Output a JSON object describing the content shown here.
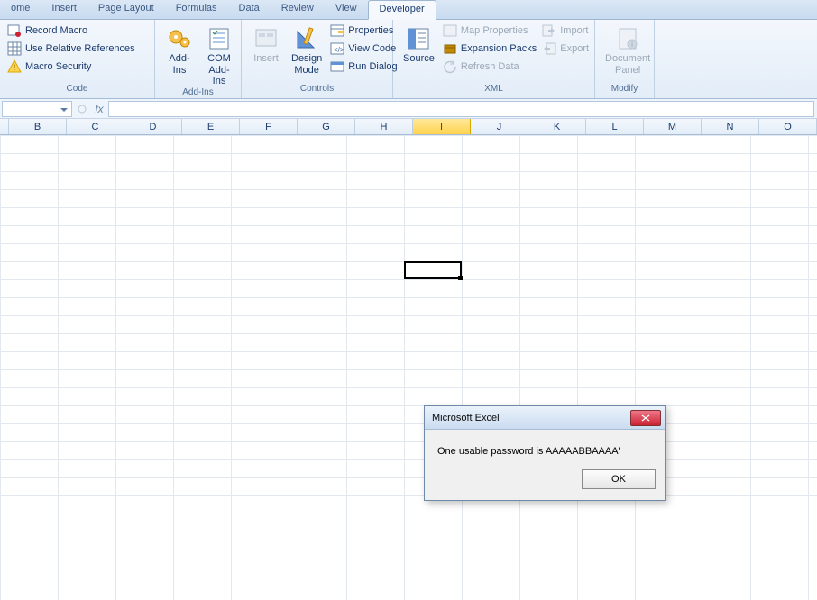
{
  "tabs": {
    "items": [
      {
        "label": "ome"
      },
      {
        "label": "Insert"
      },
      {
        "label": "Page Layout"
      },
      {
        "label": "Formulas"
      },
      {
        "label": "Data"
      },
      {
        "label": "Review"
      },
      {
        "label": "View"
      },
      {
        "label": "Developer"
      }
    ],
    "active_index": 7
  },
  "ribbon": {
    "code": {
      "label": "Code",
      "record_macro": "Record Macro",
      "use_relative": "Use Relative References",
      "macro_security": "Macro Security"
    },
    "addins": {
      "label": "Add-Ins",
      "addins_btn": "Add-Ins",
      "com_addins": "COM\nAdd-Ins"
    },
    "controls": {
      "label": "Controls",
      "insert": "Insert",
      "design_mode": "Design\nMode",
      "properties": "Properties",
      "view_code": "View Code",
      "run_dialog": "Run Dialog"
    },
    "xml": {
      "label": "XML",
      "source": "Source",
      "map_properties": "Map Properties",
      "expansion_packs": "Expansion Packs",
      "refresh_data": "Refresh Data",
      "import": "Import",
      "export": "Export"
    },
    "modify": {
      "label": "Modify",
      "document_panel": "Document\nPanel"
    }
  },
  "formula_bar": {
    "name_box": "",
    "fx": "fx"
  },
  "columns": [
    "B",
    "C",
    "D",
    "E",
    "F",
    "G",
    "H",
    "I",
    "J",
    "K",
    "L",
    "M",
    "N",
    "O"
  ],
  "selected_column": "I",
  "dialog": {
    "title": "Microsoft Excel",
    "message": "One usable password is AAAAABBAAAA'",
    "ok": "OK"
  }
}
